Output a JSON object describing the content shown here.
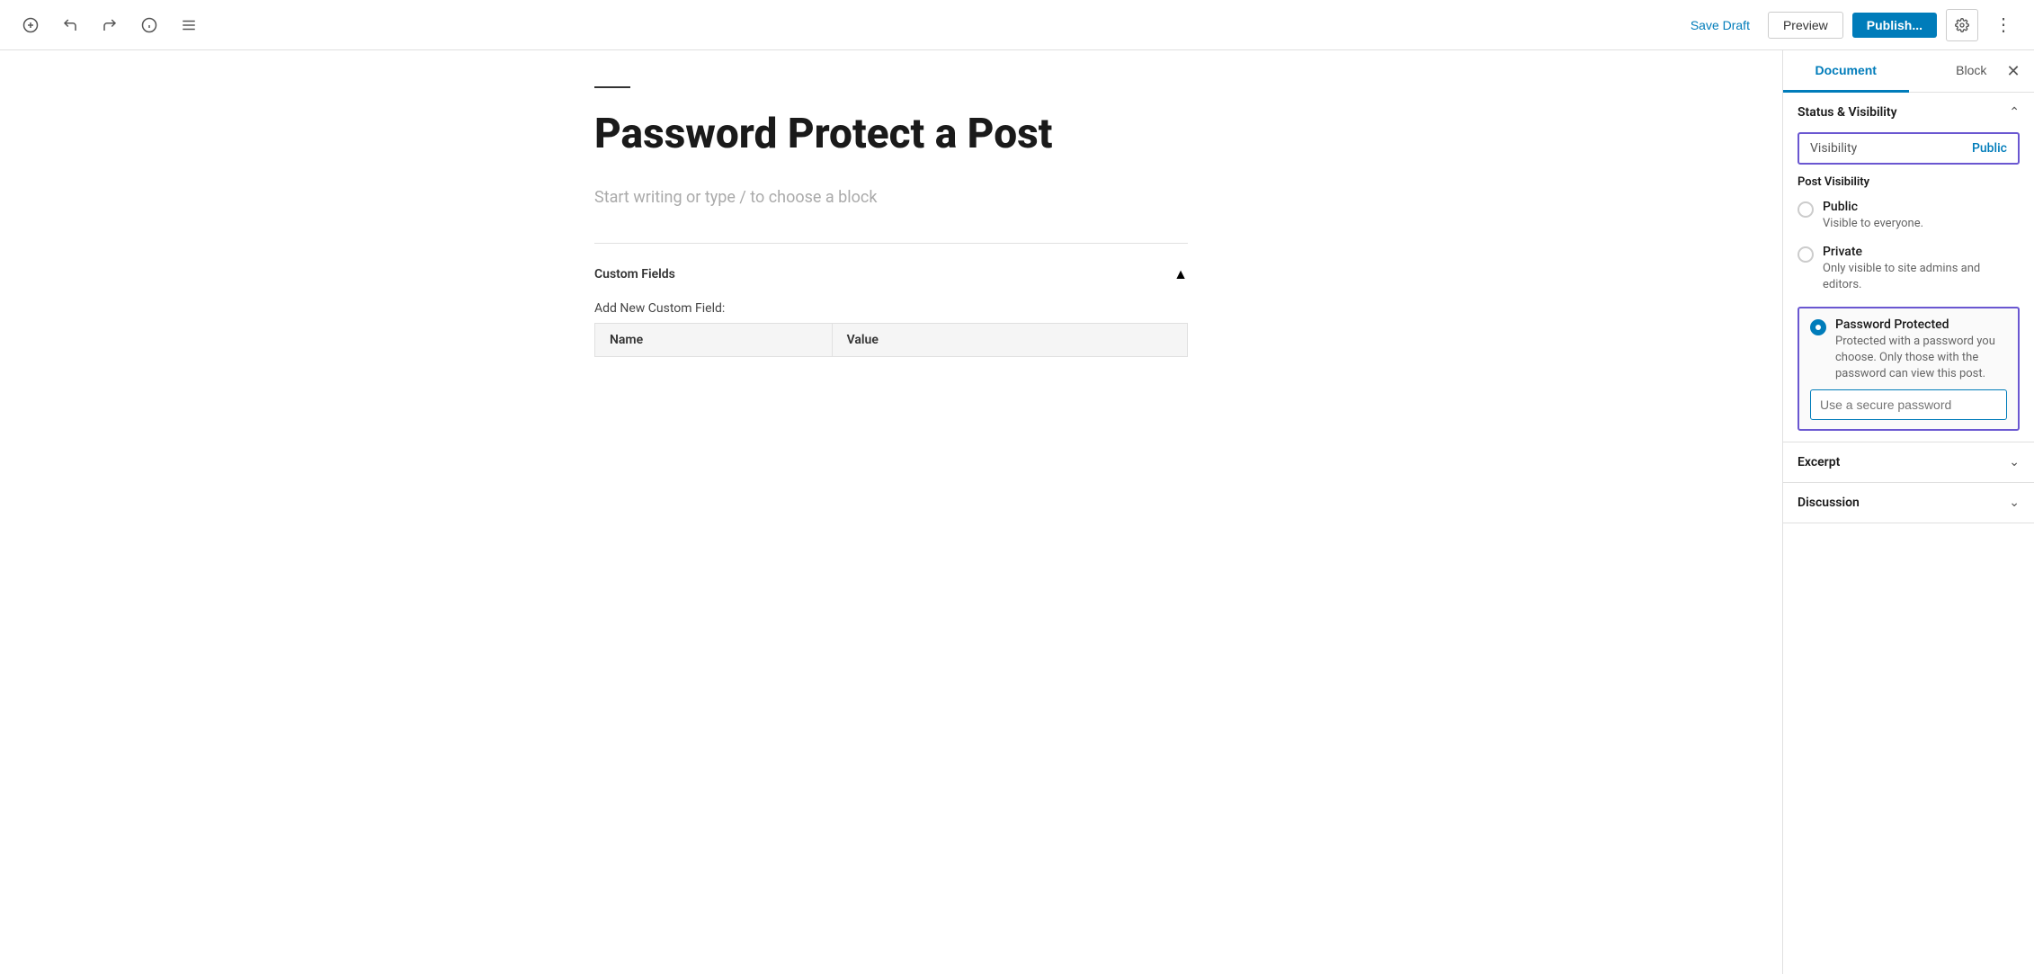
{
  "toolbar": {
    "save_draft_label": "Save Draft",
    "preview_label": "Preview",
    "publish_label": "Publish...",
    "document_tab": "Document",
    "block_tab": "Block"
  },
  "editor": {
    "post_title": "Password Protect a Post",
    "placeholder": "Start writing or type / to choose a block"
  },
  "custom_fields": {
    "title": "Custom Fields",
    "add_new_label": "Add New Custom Field:",
    "name_col": "Name",
    "value_col": "Value"
  },
  "sidebar": {
    "document_tab": "Document",
    "block_tab": "Block",
    "status_visibility_title": "Status & Visibility",
    "visibility_label": "Visibility",
    "visibility_value": "Public",
    "post_visibility_title": "Post Visibility",
    "options": [
      {
        "id": "public",
        "title": "Public",
        "desc": "Visible to everyone.",
        "checked": false
      },
      {
        "id": "private",
        "title": "Private",
        "desc": "Only visible to site admins and editors.",
        "checked": false
      },
      {
        "id": "password",
        "title": "Password Protected",
        "desc": "Protected with a password you choose. Only those with the password can view this post.",
        "checked": true
      }
    ],
    "password_placeholder": "Use a secure password",
    "excerpt_title": "Excerpt",
    "discussion_title": "Discussion"
  }
}
